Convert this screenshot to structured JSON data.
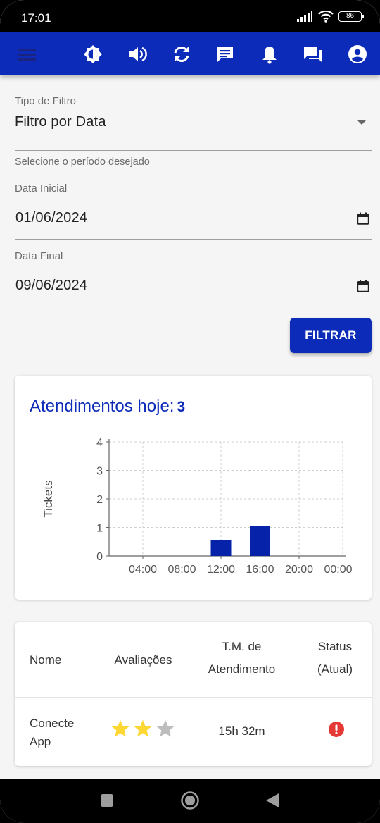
{
  "status_bar": {
    "time": "17:01",
    "battery": "86"
  },
  "app_bar": {
    "icons": [
      "menu-icon",
      "brightness-icon",
      "volume-icon",
      "sync-icon",
      "chat-icon",
      "bell-icon",
      "forum-icon",
      "account-icon"
    ],
    "color": "#0b2bb8"
  },
  "form": {
    "filter_type": {
      "label": "Tipo de Filtro",
      "value": "Filtro por Data",
      "helper": "Selecione o período desejado"
    },
    "start_date": {
      "label": "Data Inicial",
      "value": "01/06/2024"
    },
    "end_date": {
      "label": "Data Final",
      "value": "09/06/2024"
    },
    "submit_label": "FILTRAR"
  },
  "chart_card": {
    "title": "Atendimentos hoje:",
    "count": "3"
  },
  "chart_data": {
    "type": "bar",
    "ylabel": "Tickets",
    "xlabel": "",
    "ylim": [
      0,
      4
    ],
    "yticks": [
      "0",
      "1",
      "2",
      "3",
      "4"
    ],
    "xticks": [
      "04:00",
      "08:00",
      "12:00",
      "16:00",
      "20:00",
      "00:00"
    ],
    "bars": [
      {
        "x": "12:00",
        "value": 0.55
      },
      {
        "x": "16:00",
        "value": 1.05
      }
    ],
    "color": "#0522a8",
    "grid": true
  },
  "table": {
    "headers": {
      "name": "Nome",
      "ratings": "Avaliações",
      "tm_line1": "T.M. de",
      "tm_line2": "Atendimento",
      "status_line1": "Status",
      "status_line2": "(Atual)"
    },
    "rows": [
      {
        "name_line1": "Conecte",
        "name_line2": "App",
        "rating": 2,
        "rating_max": 3,
        "tm": "15h 32m",
        "status": "error"
      }
    ]
  }
}
